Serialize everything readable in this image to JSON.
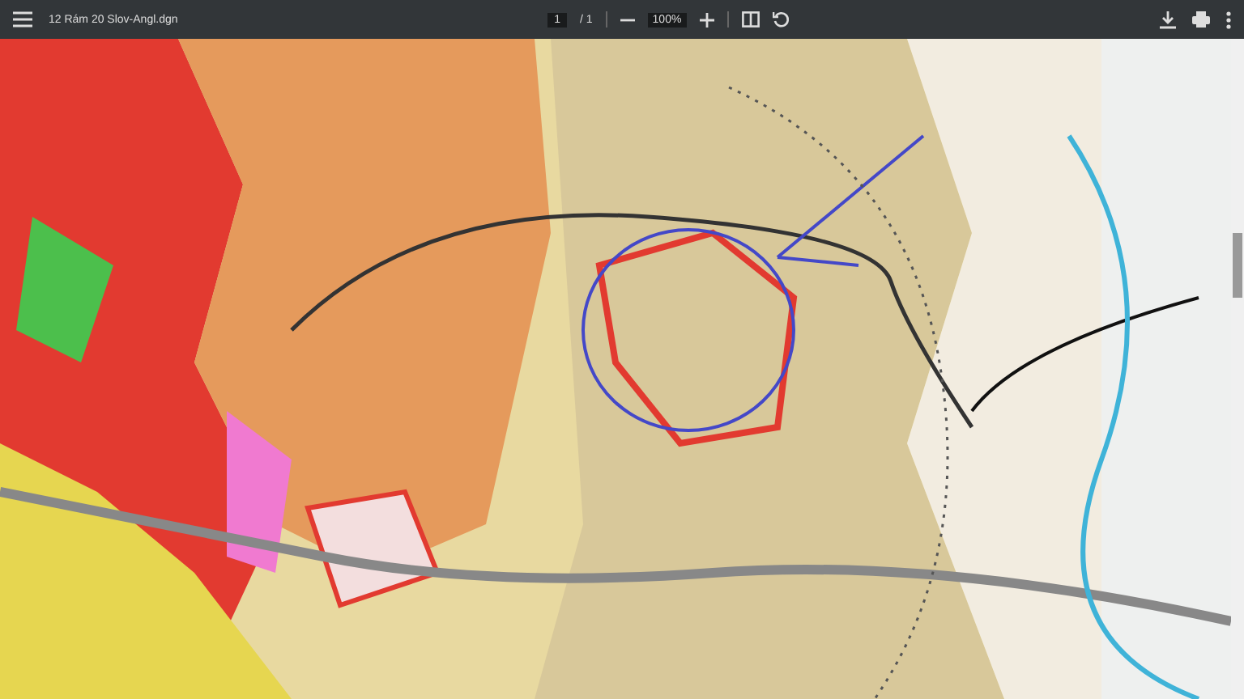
{
  "toolbar": {
    "title": "12 Rám 20 Slov-Angl.dgn",
    "page": "1",
    "page_total": "/ 1",
    "zoom": "100%"
  }
}
